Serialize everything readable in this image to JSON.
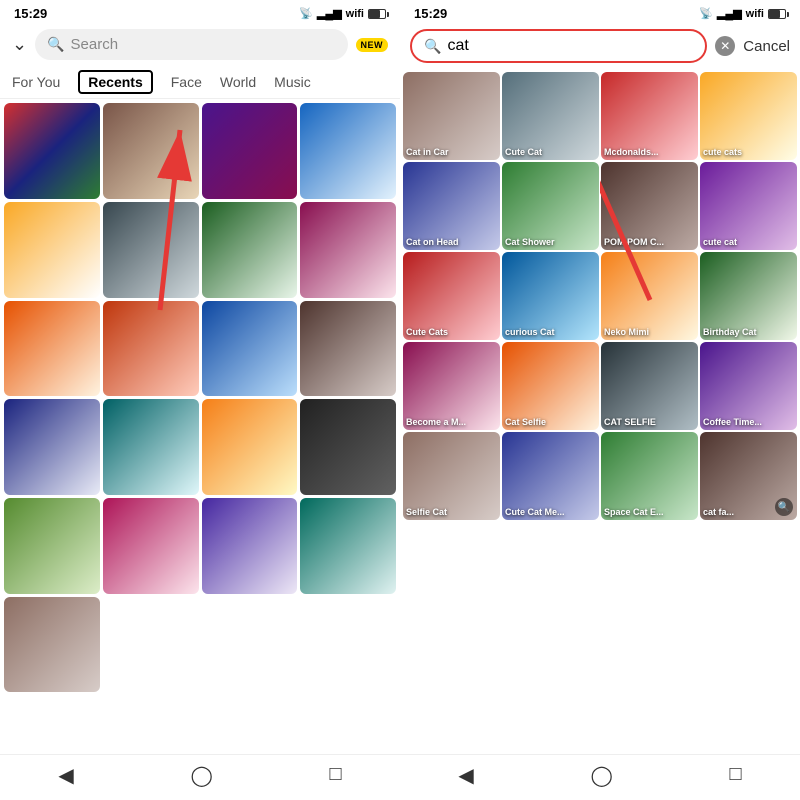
{
  "left": {
    "status": {
      "time": "15:29"
    },
    "search": {
      "placeholder": "Search",
      "new_badge": "NEW"
    },
    "tabs": [
      {
        "id": "for-you",
        "label": "For You",
        "active": false
      },
      {
        "id": "recents",
        "label": "Recents",
        "active": true
      },
      {
        "id": "face",
        "label": "Face",
        "active": false
      },
      {
        "id": "world",
        "label": "World",
        "active": false
      },
      {
        "id": "music",
        "label": "Music",
        "active": false
      }
    ],
    "grid": [
      [
        {
          "id": "r1c1",
          "color": "c1",
          "label": ""
        },
        {
          "id": "r1c2",
          "color": "c2",
          "label": ""
        },
        {
          "id": "r1c3",
          "color": "c3",
          "label": ""
        },
        {
          "id": "r1c4",
          "color": "c4",
          "label": ""
        }
      ],
      [
        {
          "id": "r2c1",
          "color": "c5",
          "label": ""
        },
        {
          "id": "r2c2",
          "color": "c6",
          "label": ""
        },
        {
          "id": "r2c3",
          "color": "c7",
          "label": ""
        },
        {
          "id": "r2c4",
          "color": "c8",
          "label": ""
        }
      ],
      [
        {
          "id": "r3c1",
          "color": "c9",
          "label": ""
        },
        {
          "id": "r3c2",
          "color": "c10",
          "label": ""
        },
        {
          "id": "r3c3",
          "color": "c11",
          "label": ""
        },
        {
          "id": "r3c4",
          "color": "c12",
          "label": ""
        }
      ],
      [
        {
          "id": "r4c1",
          "color": "c13",
          "label": ""
        },
        {
          "id": "r4c2",
          "color": "c14",
          "label": ""
        },
        {
          "id": "r4c3",
          "color": "c15",
          "label": ""
        },
        {
          "id": "r4c4",
          "color": "c16",
          "label": ""
        }
      ],
      [
        {
          "id": "r5c1",
          "color": "c17",
          "label": ""
        },
        {
          "id": "r5c2",
          "color": "c18",
          "label": ""
        },
        {
          "id": "r5c3",
          "color": "c19",
          "label": ""
        },
        {
          "id": "r5c4",
          "color": "c20",
          "label": ""
        }
      ],
      [
        {
          "id": "r6c1",
          "color": "ca",
          "label": ""
        }
      ]
    ]
  },
  "right": {
    "status": {
      "time": "15:29"
    },
    "search": {
      "query": "cat",
      "cancel_label": "Cancel"
    },
    "results": [
      [
        {
          "id": "cat-in-car",
          "color": "ca",
          "label": "Cat in Car"
        },
        {
          "id": "cute-cat",
          "color": "cb",
          "label": "Cute Cat"
        },
        {
          "id": "mcdonalds",
          "color": "cc",
          "label": "Mcdonalds..."
        },
        {
          "id": "cute-cats-sm",
          "color": "cd",
          "label": "cute cats"
        }
      ],
      [
        {
          "id": "cat-on-head",
          "color": "ce",
          "label": "Cat on Head"
        },
        {
          "id": "cat-shower",
          "color": "cf",
          "label": "Cat Shower"
        },
        {
          "id": "pom-pom",
          "color": "cg",
          "label": "POM POM C..."
        },
        {
          "id": "cute-cat-2",
          "color": "ch",
          "label": "cute cat"
        }
      ],
      [
        {
          "id": "cute-cats-big",
          "color": "ci",
          "label": "Cute Cats"
        },
        {
          "id": "curious-cat",
          "color": "cj",
          "label": "curious Cat"
        },
        {
          "id": "neko-mimi",
          "color": "ck",
          "label": "Neko Mimi"
        },
        {
          "id": "birthday-cat",
          "color": "cl",
          "label": "Birthday Cat"
        }
      ],
      [
        {
          "id": "become-m",
          "color": "cm",
          "label": "Become a M..."
        },
        {
          "id": "cat-selfie",
          "color": "cn",
          "label": "Cat Selfie"
        },
        {
          "id": "cat-selfie-caps",
          "color": "co",
          "label": "CAT SELFIE"
        },
        {
          "id": "coffee-time",
          "color": "cp",
          "label": "Coffee Time..."
        }
      ],
      [
        {
          "id": "selfie-cat",
          "color": "ca",
          "label": "Selfie Cat"
        },
        {
          "id": "cute-cat-me",
          "color": "ce",
          "label": "Cute Cat Me..."
        },
        {
          "id": "space-cat-e",
          "color": "cf",
          "label": "Space Cat E..."
        },
        {
          "id": "cat-fa",
          "color": "cg",
          "label": "cat fa...",
          "has_search": true
        }
      ]
    ]
  }
}
